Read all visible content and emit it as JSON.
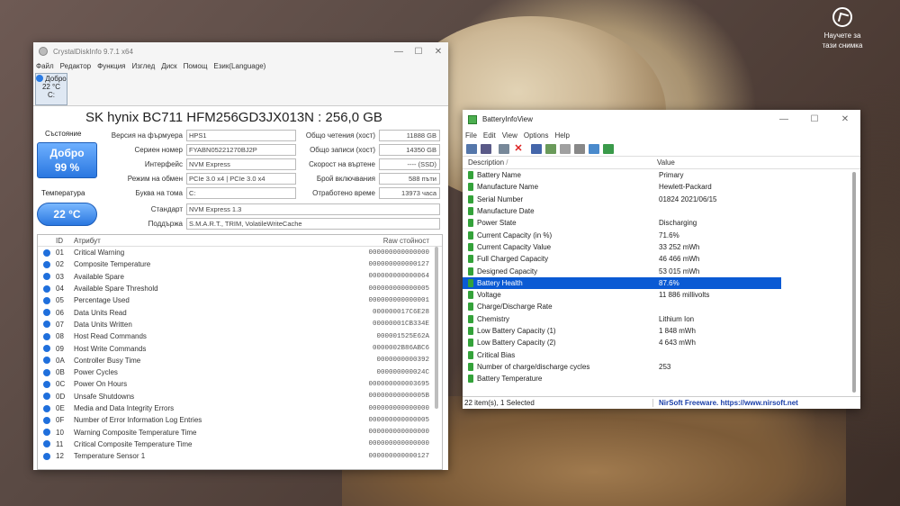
{
  "desktop": {
    "learn_label_1": "Научете за",
    "learn_label_2": "тази снимка"
  },
  "cdi": {
    "title": "CrystalDiskInfo 9.7.1 x64",
    "menu": [
      "Файл",
      "Редактор",
      "Функция",
      "Изглед",
      "Диск",
      "Помощ",
      "Език(Language)"
    ],
    "disk_tab": {
      "status": "Добро",
      "temp": "22 °C",
      "letter": "C:"
    },
    "model": "SK hynix BC711 HFM256GD3JX013N : 256,0 GB",
    "health_label": "Състояние",
    "health_status": "Добро",
    "health_percent": "99 %",
    "temp_label": "Температура",
    "temp_value": "22 °C",
    "left_fields": [
      {
        "k": "Версия на фърмуера",
        "v": "HPS1"
      },
      {
        "k": "Сериен номер",
        "v": "FYABN05221270BJ2P"
      },
      {
        "k": "Интерфейс",
        "v": "NVM Express"
      },
      {
        "k": "Режим на обмен",
        "v": "PCIe 3.0 x4 | PCIe 3.0 x4"
      },
      {
        "k": "Буква на тома",
        "v": "C:"
      }
    ],
    "right_fields": [
      {
        "k": "Общо четения (хост)",
        "v": "11888 GB"
      },
      {
        "k": "Общо записи (хост)",
        "v": "14350 GB"
      },
      {
        "k": "Скорост на въртене",
        "v": "---- (SSD)"
      },
      {
        "k": "Брой включвания",
        "v": "588 пъти"
      },
      {
        "k": "Отработено време",
        "v": "13973 часа"
      }
    ],
    "standard_label": "Стандарт",
    "standard_value": "NVM Express 1.3",
    "support_label": "Поддържа",
    "support_value": "S.M.A.R.T., TRIM, VolatileWriteCache",
    "table_headers": {
      "id": "ID",
      "attr": "Атрибут",
      "raw": "Raw стойност"
    },
    "attributes": [
      {
        "id": "01",
        "name": "Critical Warning",
        "raw": "000000000000000"
      },
      {
        "id": "02",
        "name": "Composite Temperature",
        "raw": "000000000000127"
      },
      {
        "id": "03",
        "name": "Available Spare",
        "raw": "000000000000064"
      },
      {
        "id": "04",
        "name": "Available Spare Threshold",
        "raw": "000000000000005"
      },
      {
        "id": "05",
        "name": "Percentage Used",
        "raw": "000000000000001"
      },
      {
        "id": "06",
        "name": "Data Units Read",
        "raw": "000000017C6E28"
      },
      {
        "id": "07",
        "name": "Data Units Written",
        "raw": "00000001CB334E"
      },
      {
        "id": "08",
        "name": "Host Read Commands",
        "raw": "000001525E62A"
      },
      {
        "id": "09",
        "name": "Host Write Commands",
        "raw": "0000002B86ABC6"
      },
      {
        "id": "0A",
        "name": "Controller Busy Time",
        "raw": "0000000000392"
      },
      {
        "id": "0B",
        "name": "Power Cycles",
        "raw": "000000000024C"
      },
      {
        "id": "0C",
        "name": "Power On Hours",
        "raw": "000000000003695"
      },
      {
        "id": "0D",
        "name": "Unsafe Shutdowns",
        "raw": "00000000000005B"
      },
      {
        "id": "0E",
        "name": "Media and Data Integrity Errors",
        "raw": "000000000000000"
      },
      {
        "id": "0F",
        "name": "Number of Error Information Log Entries",
        "raw": "000000000000005"
      },
      {
        "id": "10",
        "name": "Warning Composite Temperature Time",
        "raw": "000000000000000"
      },
      {
        "id": "11",
        "name": "Critical Composite Temperature Time",
        "raw": "000000000000000"
      },
      {
        "id": "12",
        "name": "Temperature Sensor 1",
        "raw": "000000000000127"
      }
    ]
  },
  "biv": {
    "title": "BatteryInfoView",
    "menu": [
      "File",
      "Edit",
      "View",
      "Options",
      "Help"
    ],
    "col_description": "Description",
    "col_value": "Value",
    "rows": [
      {
        "d": "Battery Name",
        "v": "Primary"
      },
      {
        "d": "Manufacture Name",
        "v": "Hewlett-Packard"
      },
      {
        "d": "Serial Number",
        "v": "01824 2021/06/15"
      },
      {
        "d": "Manufacture Date",
        "v": ""
      },
      {
        "d": "Power State",
        "v": "Discharging"
      },
      {
        "d": "Current Capacity (in %)",
        "v": "71.6%"
      },
      {
        "d": "Current Capacity Value",
        "v": "33 252 mWh"
      },
      {
        "d": "Full Charged Capacity",
        "v": "46 466 mWh"
      },
      {
        "d": "Designed Capacity",
        "v": "53 015 mWh"
      },
      {
        "d": "Battery Health",
        "v": "87.6%"
      },
      {
        "d": "Voltage",
        "v": "11 886 millivolts"
      },
      {
        "d": "Charge/Discharge Rate",
        "v": ""
      },
      {
        "d": "Chemistry",
        "v": "Lithium Ion"
      },
      {
        "d": "Low Battery Capacity (1)",
        "v": "1 848 mWh"
      },
      {
        "d": "Low Battery Capacity (2)",
        "v": "4 643 mWh"
      },
      {
        "d": "Critical Bias",
        "v": ""
      },
      {
        "d": "Number of charge/discharge cycles",
        "v": "253"
      },
      {
        "d": "Battery Temperature",
        "v": ""
      }
    ],
    "selected_index": 9,
    "status_left": "22 item(s), 1 Selected",
    "status_right": "NirSoft Freeware. https://www.nirsoft.net"
  },
  "colors": {
    "selection": "#0a5ad4",
    "health_blue": "#2a77e0",
    "battery_green": "#34a23a"
  }
}
